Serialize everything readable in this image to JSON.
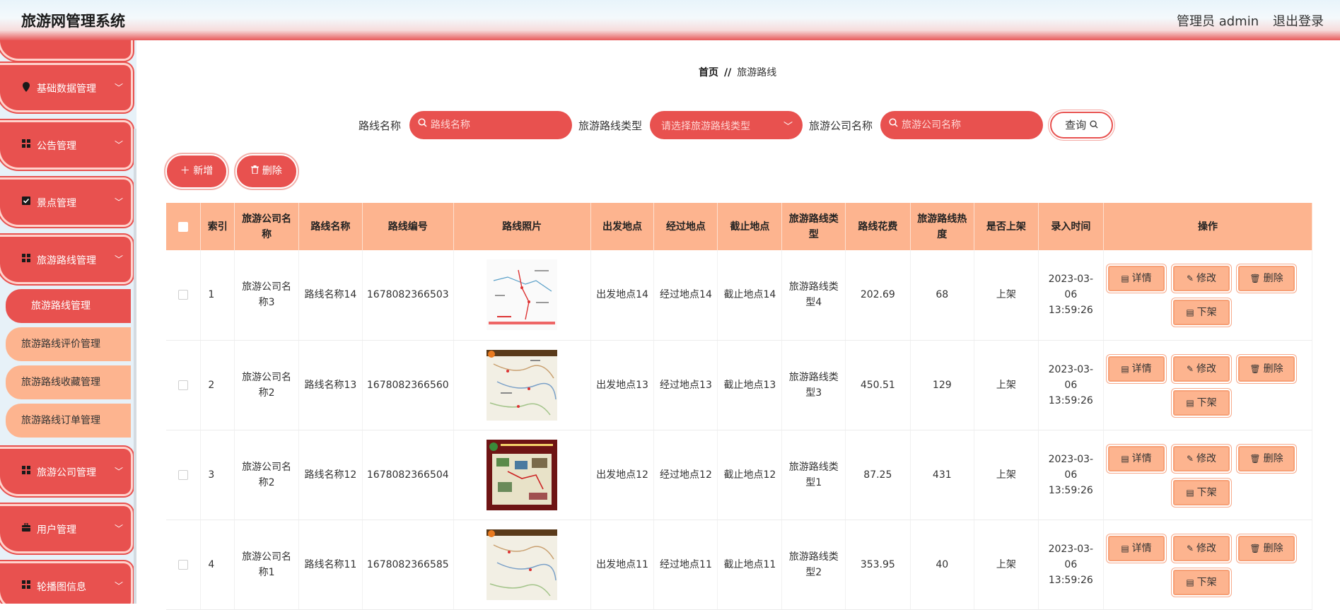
{
  "header": {
    "title": "旅游网管理系统",
    "admin": "管理员 admin",
    "logout": "退出登录"
  },
  "sidebar": {
    "groups": [
      {
        "label": "基础数据管理",
        "icon": "location-pin-icon"
      },
      {
        "label": "公告管理",
        "icon": "grid-icon"
      },
      {
        "label": "景点管理",
        "icon": "checkbox-icon"
      },
      {
        "label": "旅游路线管理",
        "icon": "grid-icon"
      },
      {
        "label": "旅游公司管理",
        "icon": "grid-icon"
      },
      {
        "label": "用户管理",
        "icon": "briefcase-icon"
      },
      {
        "label": "轮播图信息",
        "icon": "grid-icon"
      }
    ],
    "sub_items": [
      "旅游路线管理",
      "旅游路线评价管理",
      "旅游路线收藏管理",
      "旅游路线订单管理"
    ]
  },
  "breadcrumb": {
    "home": "首页",
    "sep": "//",
    "current": "旅游路线"
  },
  "filters": {
    "route_name_label": "路线名称",
    "route_name_placeholder": "路线名称",
    "route_type_label": "旅游路线类型",
    "route_type_placeholder": "请选择旅游路线类型",
    "company_label": "旅游公司名称",
    "company_placeholder": "旅游公司名称",
    "query": "查询"
  },
  "actions": {
    "add": "新增",
    "delete": "删除"
  },
  "table": {
    "headers": [
      "索引",
      "旅游公司名称",
      "路线名称",
      "路线编号",
      "路线照片",
      "出发地点",
      "经过地点",
      "截止地点",
      "旅游路线类型",
      "路线花费",
      "旅游路线热度",
      "是否上架",
      "录入时间",
      "操作"
    ],
    "ops": {
      "detail": "详情",
      "edit": "修改",
      "delete": "删除",
      "offshelf": "下架"
    },
    "rows": [
      {
        "idx": "1",
        "company": "旅游公司名称3",
        "name": "路线名称14",
        "code": "1678082366503",
        "from": "出发地点14",
        "via": "经过地点14",
        "to": "截止地点14",
        "type": "旅游路线类型4",
        "cost": "202.69",
        "heat": "68",
        "shelf": "上架",
        "time": "2023-03-06 13:59:26"
      },
      {
        "idx": "2",
        "company": "旅游公司名称2",
        "name": "路线名称13",
        "code": "1678082366560",
        "from": "出发地点13",
        "via": "经过地点13",
        "to": "截止地点13",
        "type": "旅游路线类型3",
        "cost": "450.51",
        "heat": "129",
        "shelf": "上架",
        "time": "2023-03-06 13:59:26"
      },
      {
        "idx": "3",
        "company": "旅游公司名称2",
        "name": "路线名称12",
        "code": "1678082366504",
        "from": "出发地点12",
        "via": "经过地点12",
        "to": "截止地点12",
        "type": "旅游路线类型1",
        "cost": "87.25",
        "heat": "431",
        "shelf": "上架",
        "time": "2023-03-06 13:59:26"
      },
      {
        "idx": "4",
        "company": "旅游公司名称1",
        "name": "路线名称11",
        "code": "1678082366585",
        "from": "出发地点11",
        "via": "经过地点11",
        "to": "截止地点11",
        "type": "旅游路线类型2",
        "cost": "353.95",
        "heat": "40",
        "shelf": "上架",
        "time": "2023-03-06 13:59:26"
      }
    ]
  }
}
